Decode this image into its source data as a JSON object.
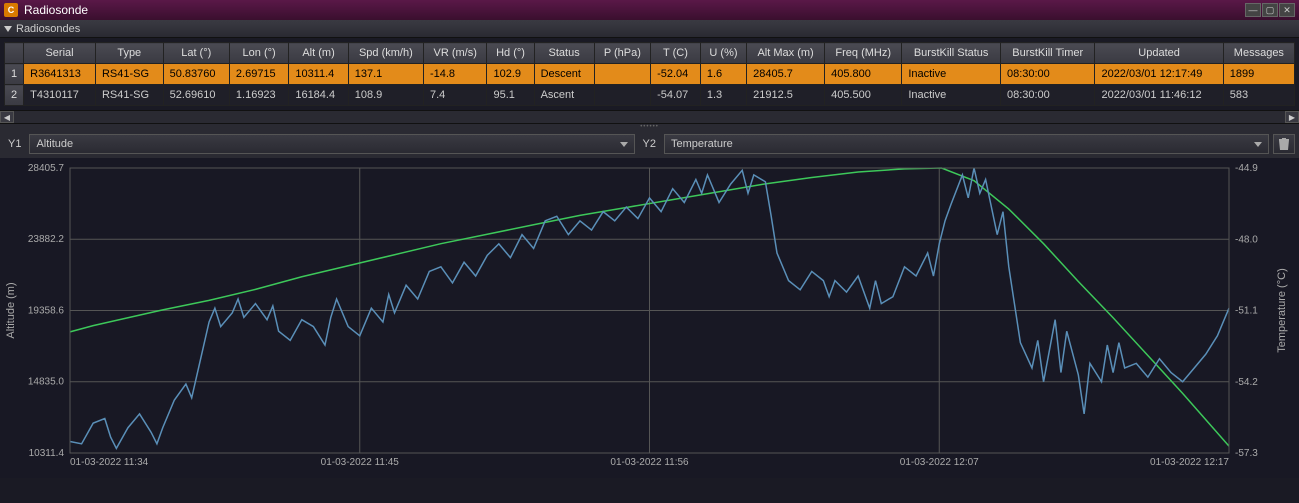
{
  "titlebar": {
    "icon": "C",
    "title": "Radiosonde"
  },
  "panel": {
    "header": "Radiosondes"
  },
  "table": {
    "headers": [
      "Serial",
      "Type",
      "Lat (°)",
      "Lon (°)",
      "Alt (m)",
      "Spd (km/h)",
      "VR (m/s)",
      "Hd (°)",
      "Status",
      "P (hPa)",
      "T (C)",
      "U (%)",
      "Alt Max (m)",
      "Freq (MHz)",
      "BurstKill Status",
      "BurstKill Timer",
      "Updated",
      "Messages"
    ],
    "rows": [
      {
        "n": "1",
        "selected": true,
        "cells": [
          "R3641313",
          "RS41-SG",
          "50.83760",
          "2.69715",
          "10311.4",
          "137.1",
          "-14.8",
          "102.9",
          "Descent",
          "",
          "-52.04",
          "1.6",
          "28405.7",
          "405.800",
          "Inactive",
          "08:30:00",
          "2022/03/01 12:17:49",
          "1899"
        ]
      },
      {
        "n": "2",
        "selected": false,
        "cells": [
          "T4310117",
          "RS41-SG",
          "52.69610",
          "1.16923",
          "16184.4",
          "108.9",
          "7.4",
          "95.1",
          "Ascent",
          "",
          "-54.07",
          "1.3",
          "21912.5",
          "405.500",
          "Inactive",
          "08:30:00",
          "2022/03/01 11:46:12",
          "583"
        ]
      }
    ]
  },
  "axis_controls": {
    "y1_label": "Y1",
    "y1_value": "Altitude",
    "y2_label": "Y2",
    "y2_value": "Temperature"
  },
  "chart_data": {
    "type": "line",
    "xlabel": "",
    "y1label": "Altitude (m)",
    "y2label": "Temperature (°C)",
    "x_ticks": [
      "01-03-2022 11:34",
      "01-03-2022 11:45",
      "01-03-2022 11:56",
      "01-03-2022 12:07",
      "01-03-2022 12:17"
    ],
    "y1_ticks": [
      10311.4,
      14835.0,
      19358.6,
      23882.2,
      28405.7
    ],
    "y2_ticks": [
      -57.3,
      -54.2,
      -51.1,
      -48.0,
      -44.9
    ],
    "y1_range": [
      10311.4,
      28405.7
    ],
    "y2_range": [
      -57.3,
      -44.9
    ],
    "series": [
      {
        "name": "Altitude",
        "axis": "y1",
        "color": "#3dc85a",
        "x": [
          0,
          0.02,
          0.05,
          0.08,
          0.12,
          0.16,
          0.2,
          0.24,
          0.28,
          0.32,
          0.36,
          0.4,
          0.44,
          0.48,
          0.52,
          0.56,
          0.6,
          0.64,
          0.68,
          0.72,
          0.752,
          0.78,
          0.81,
          0.84,
          0.87,
          0.9,
          0.93,
          0.96,
          1.0
        ],
        "values": [
          18000,
          18400,
          18900,
          19400,
          20000,
          20700,
          21500,
          22200,
          22900,
          23600,
          24200,
          24800,
          25400,
          25900,
          26400,
          26900,
          27400,
          27800,
          28150,
          28350,
          28405.7,
          27600,
          25800,
          23600,
          21200,
          18900,
          16500,
          14100,
          10750
        ]
      },
      {
        "name": "Temperature",
        "axis": "y2",
        "color": "#5a8fb8",
        "x": [
          0,
          0.01,
          0.02,
          0.03,
          0.035,
          0.04,
          0.05,
          0.06,
          0.07,
          0.075,
          0.08,
          0.09,
          0.1,
          0.105,
          0.11,
          0.12,
          0.125,
          0.13,
          0.14,
          0.145,
          0.15,
          0.16,
          0.17,
          0.175,
          0.18,
          0.19,
          0.2,
          0.21,
          0.22,
          0.225,
          0.23,
          0.24,
          0.25,
          0.26,
          0.27,
          0.275,
          0.28,
          0.29,
          0.3,
          0.31,
          0.32,
          0.33,
          0.34,
          0.35,
          0.36,
          0.37,
          0.38,
          0.39,
          0.4,
          0.41,
          0.42,
          0.43,
          0.44,
          0.45,
          0.46,
          0.47,
          0.48,
          0.49,
          0.5,
          0.51,
          0.52,
          0.53,
          0.54,
          0.545,
          0.55,
          0.56,
          0.57,
          0.58,
          0.585,
          0.59,
          0.6,
          0.605,
          0.61,
          0.62,
          0.63,
          0.64,
          0.65,
          0.655,
          0.66,
          0.67,
          0.68,
          0.69,
          0.695,
          0.7,
          0.71,
          0.72,
          0.73,
          0.74,
          0.745,
          0.75,
          0.755,
          0.76,
          0.77,
          0.775,
          0.78,
          0.785,
          0.79,
          0.8,
          0.805,
          0.81,
          0.82,
          0.83,
          0.835,
          0.84,
          0.85,
          0.855,
          0.86,
          0.87,
          0.875,
          0.88,
          0.89,
          0.895,
          0.9,
          0.905,
          0.91,
          0.92,
          0.93,
          0.94,
          0.95,
          0.96,
          0.97,
          0.98,
          0.99,
          1.0
        ],
        "values": [
          -56.8,
          -56.9,
          -56.0,
          -55.8,
          -56.6,
          -57.1,
          -56.2,
          -55.6,
          -56.4,
          -56.9,
          -56.2,
          -55.0,
          -54.3,
          -54.9,
          -53.8,
          -51.6,
          -51.0,
          -51.8,
          -51.2,
          -50.6,
          -51.4,
          -50.8,
          -51.5,
          -50.9,
          -52.0,
          -52.4,
          -51.5,
          -51.8,
          -52.6,
          -51.4,
          -50.6,
          -51.8,
          -52.2,
          -51.0,
          -51.6,
          -50.4,
          -51.2,
          -50.0,
          -50.6,
          -49.4,
          -49.2,
          -49.9,
          -49.0,
          -49.6,
          -48.7,
          -48.2,
          -48.8,
          -47.8,
          -48.4,
          -47.2,
          -47.0,
          -47.8,
          -47.2,
          -47.6,
          -46.8,
          -47.2,
          -46.6,
          -47.1,
          -46.2,
          -46.8,
          -45.8,
          -46.4,
          -45.4,
          -46.0,
          -45.2,
          -46.4,
          -45.6,
          -45.0,
          -46.0,
          -45.2,
          -45.5,
          -47.0,
          -48.6,
          -49.8,
          -50.2,
          -49.4,
          -49.8,
          -50.5,
          -49.8,
          -50.3,
          -49.6,
          -51.0,
          -49.8,
          -50.8,
          -50.5,
          -49.2,
          -49.6,
          -48.6,
          -49.6,
          -48.2,
          -47.2,
          -46.5,
          -45.2,
          -46.2,
          -44.9,
          -46.0,
          -45.4,
          -47.8,
          -46.8,
          -49.2,
          -52.5,
          -53.6,
          -52.4,
          -54.2,
          -51.5,
          -53.8,
          -52.0,
          -53.9,
          -55.6,
          -53.4,
          -54.2,
          -52.6,
          -53.8,
          -52.5,
          -53.6,
          -53.4,
          -54.0,
          -53.2,
          -53.8,
          -54.2,
          -53.6,
          -53.0,
          -52.2,
          -51.0
        ]
      }
    ]
  }
}
